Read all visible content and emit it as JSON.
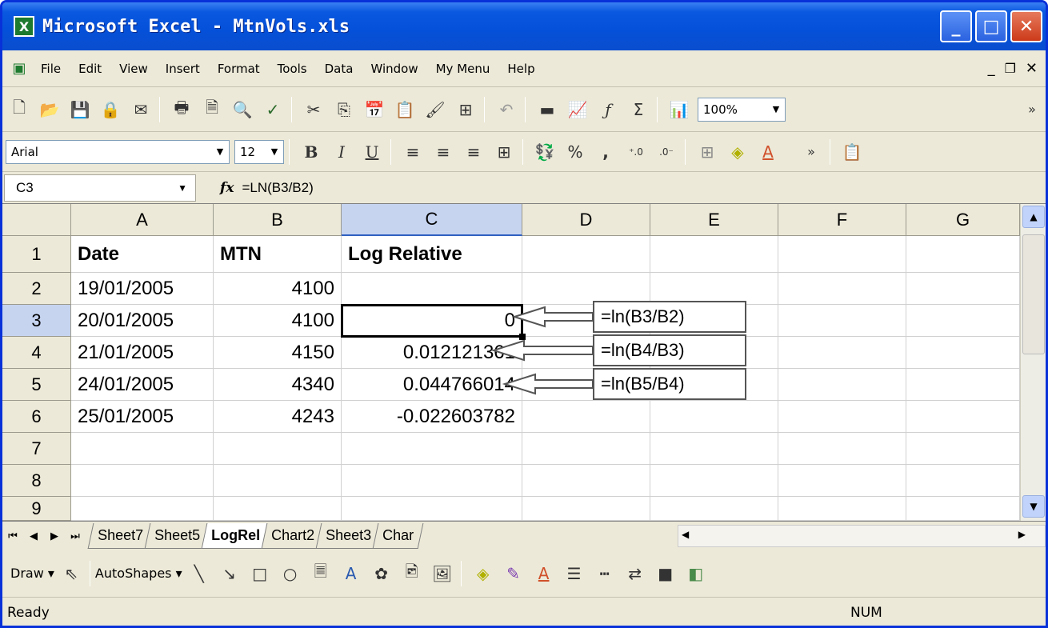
{
  "window": {
    "title": "Microsoft Excel - MtnVols.xls",
    "app_icon": "excel-icon"
  },
  "menu": [
    "File",
    "Edit",
    "View",
    "Insert",
    "Format",
    "Tools",
    "Data",
    "Window",
    "My Menu",
    "Help"
  ],
  "toolbar": {
    "zoom": "100%"
  },
  "format_toolbar": {
    "font": "Arial",
    "size": "12",
    "bold": "B",
    "italic": "I",
    "underline": "U",
    "percent": "%",
    "comma": ","
  },
  "formula_bar": {
    "name_box": "C3",
    "fx": "fx",
    "formula": "=LN(B3/B2)"
  },
  "columns": [
    "A",
    "B",
    "C",
    "D",
    "E",
    "F",
    "G"
  ],
  "rows": [
    "1",
    "2",
    "3",
    "4",
    "5",
    "6",
    "7",
    "8",
    "9"
  ],
  "cells": {
    "r1": [
      "Date",
      "MTN",
      "Log Relative"
    ],
    "r2": [
      "19/01/2005",
      "4100",
      ""
    ],
    "r3": [
      "20/01/2005",
      "4100",
      "0"
    ],
    "r4": [
      "21/01/2005",
      "4150",
      "0.012121361"
    ],
    "r5": [
      "24/01/2005",
      "4340",
      "0.044766014"
    ],
    "r6": [
      "25/01/2005",
      "4243",
      "-0.022603782"
    ]
  },
  "callouts": [
    "=ln(B3/B2)",
    "=ln(B4/B3)",
    "=ln(B5/B4)"
  ],
  "sheet_tabs": [
    "Sheet7",
    "Sheet5",
    "LogRel",
    "Chart2",
    "Sheet3",
    "Char"
  ],
  "active_tab": "LogRel",
  "draw_toolbar": {
    "draw": "Draw",
    "autoshapes": "AutoShapes"
  },
  "status": {
    "text": "Ready",
    "num": "NUM"
  }
}
